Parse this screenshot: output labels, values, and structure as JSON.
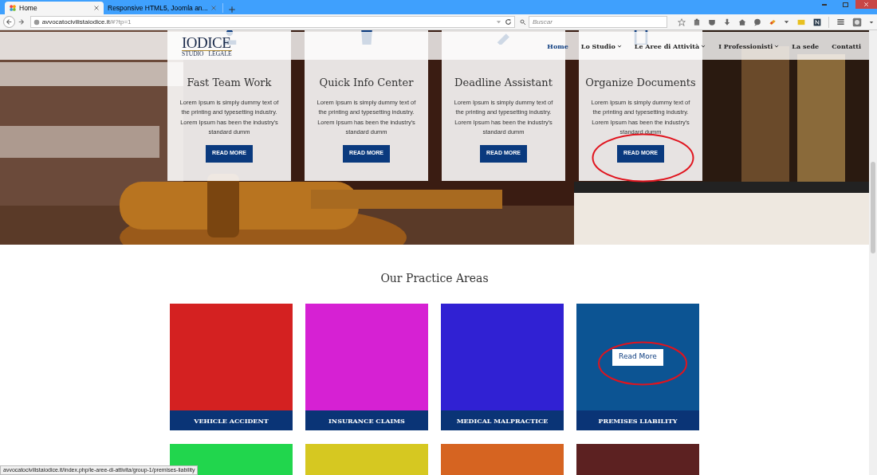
{
  "browser": {
    "tabs": [
      {
        "title": "Home",
        "selected": true
      },
      {
        "title": "Responsive HTML5, Joomla an...",
        "selected": false
      }
    ],
    "address": {
      "host": "avvocatocivilistaiodice.it",
      "path": "/#?tp=1"
    },
    "search": {
      "placeholder": "Buscar"
    }
  },
  "header": {
    "logo": {
      "name": "IODICE",
      "left": "STUDIO",
      "right": "LEGALE"
    },
    "nav": [
      {
        "label": "Home",
        "selected": true,
        "dropdown": false
      },
      {
        "label": "Lo Studio",
        "selected": false,
        "dropdown": true
      },
      {
        "label": "Le Aree di Attività",
        "selected": false,
        "dropdown": true
      },
      {
        "label": "I Professionisti",
        "selected": false,
        "dropdown": true
      },
      {
        "label": "La sede",
        "selected": false,
        "dropdown": false
      },
      {
        "label": "Contatti",
        "selected": false,
        "dropdown": false
      }
    ]
  },
  "features": [
    {
      "title": "Fast Team Work",
      "text": "Lorem Ipsum is simply dummy text of the printing and typesetting industry. Lorem Ipsum has been the industry's standard dumm",
      "button": "READ MORE",
      "highlighted": false
    },
    {
      "title": "Quick Info Center",
      "text": "Lorem Ipsum is simply dummy text of the printing and typesetting industry. Lorem Ipsum has been the industry's standard dumm",
      "button": "READ MORE",
      "highlighted": false
    },
    {
      "title": "Deadline Assistant",
      "text": "Lorem Ipsum is simply dummy text of the printing and typesetting industry. Lorem Ipsum has been the industry's standard dumm",
      "button": "READ MORE",
      "highlighted": false
    },
    {
      "title": "Organize Documents",
      "text": "Lorem Ipsum is simply dummy text of the printing and typesetting industry. Lorem Ipsum has been the industry's standard dumm",
      "button": "READ MORE",
      "highlighted": true
    }
  ],
  "practice": {
    "heading": "Our Practice Areas",
    "areas": [
      {
        "label": "VEHICLE ACCIDENT",
        "color": "#d42121",
        "highlighted": false
      },
      {
        "label": "INSURANCE CLAIMS",
        "color": "#d621d3",
        "highlighted": false
      },
      {
        "label": "MEDICAL MALPRACTICE",
        "color": "#3021d3",
        "highlighted": false
      },
      {
        "label": "PREMISES LIABILITY",
        "color": "#0c5493",
        "hover_button": "Read More",
        "highlighted": true
      },
      {
        "color": "#21d64d",
        "highlighted": false
      },
      {
        "color": "#d6c821",
        "highlighted": false
      },
      {
        "color": "#d66421",
        "highlighted": false
      },
      {
        "color": "#5c2121",
        "highlighted": false
      }
    ]
  },
  "status_bar": {
    "url": "avvocatocivilistaiodice.it/index.php/le-aree-di-attivita/group-1/premises-liability"
  }
}
